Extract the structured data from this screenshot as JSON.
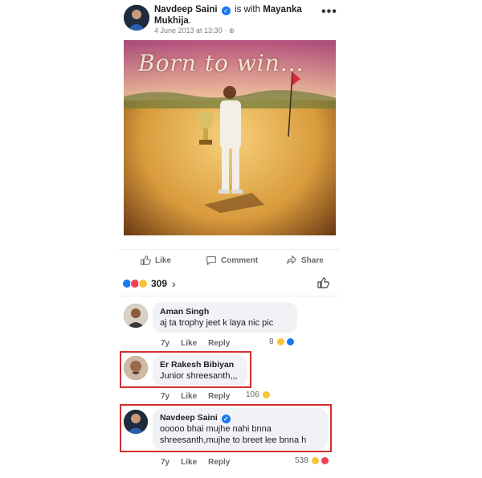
{
  "post": {
    "author": "Navdeep Saini",
    "with_text": "is with",
    "tagged": "Mayanka Mukhija",
    "timestamp": "4 June 2013 at 13:30 ·",
    "more_icon": "more-dots-icon",
    "photo_caption": "Born to win...",
    "verified_glyph": "✓",
    "dot": "."
  },
  "actions": {
    "like": "Like",
    "comment": "Comment",
    "share": "Share"
  },
  "reactions": {
    "count": "309",
    "chevron": "›",
    "types": [
      "like",
      "love",
      "haha"
    ]
  },
  "comments": [
    {
      "author": "Aman Singh",
      "text": "aj ta trophy jeet k laya nic pic",
      "age": "7y",
      "like": "Like",
      "reply": "Reply",
      "react_count": "8",
      "highlighted": false
    },
    {
      "author": "Er Rakesh Bibiyan",
      "text": "Junior shreesanth,,,",
      "age": "7y",
      "like": "Like",
      "reply": "Reply",
      "react_count": "106",
      "highlighted": true
    },
    {
      "author": "Navdeep Saini",
      "text": "ooooo bhai mujhe nahi bnna shreesanth,mujhe to breet lee bnna h",
      "age": "7y",
      "like": "Like",
      "reply": "Reply",
      "react_count": "538",
      "highlighted": true
    }
  ],
  "colors": {
    "accent": "#1877f2",
    "highlight": "#d32f2f",
    "bubble": "#f0f2f5"
  }
}
